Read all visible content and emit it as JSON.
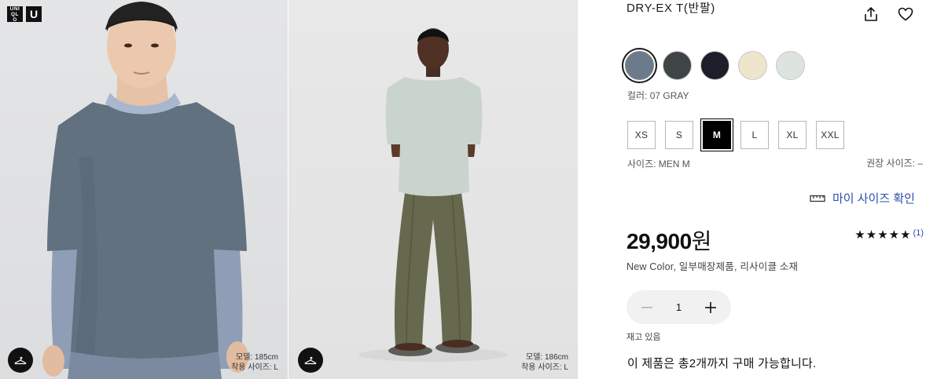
{
  "brand": {
    "logo_left": "UNI QLO",
    "logo_right": "U"
  },
  "gallery": [
    {
      "model_height": "모델: 185cm",
      "worn_size": "착용 사이즈: L",
      "hanger_icon": "hanger-icon"
    },
    {
      "model_height": "모델: 186cm",
      "worn_size": "착용 사이즈: L",
      "hanger_icon": "hanger-icon"
    }
  ],
  "product": {
    "title": "DRY-EX T(반팔)",
    "share_icon": "share-icon",
    "favorite_icon": "heart-icon",
    "colors": [
      {
        "hex": "#6b7b8c",
        "selected": true
      },
      {
        "hex": "#3f4447",
        "selected": false
      },
      {
        "hex": "#1c1e29",
        "selected": false
      },
      {
        "hex": "#efe4cc",
        "selected": false
      },
      {
        "hex": "#dde4dd",
        "selected": false
      }
    ],
    "color_label": "컬러: 07 GRAY",
    "sizes": [
      {
        "label": "XS",
        "selected": false
      },
      {
        "label": "S",
        "selected": false
      },
      {
        "label": "M",
        "selected": true
      },
      {
        "label": "L",
        "selected": false
      },
      {
        "label": "XL",
        "selected": false
      },
      {
        "label": "XXL",
        "selected": false
      }
    ],
    "size_label": "사이즈: MEN M",
    "recommended_size": "권장 사이즈: –",
    "my_size_link": "마이 사이즈 확인",
    "price": "29,900",
    "currency": "원",
    "rating_stars": "★★★★★",
    "rating_count": "(1)",
    "tags": "New Color,  일부매장제품,  리사이클 소재",
    "quantity": "1",
    "stock_status": "재고 있음",
    "purchase_limit": "이 제품은 총2개까지 구매 가능합니다."
  },
  "colors": {
    "accent": "#2b4fa8",
    "text": "#1b1b1b",
    "qty_bg": "#f1f1f1"
  }
}
